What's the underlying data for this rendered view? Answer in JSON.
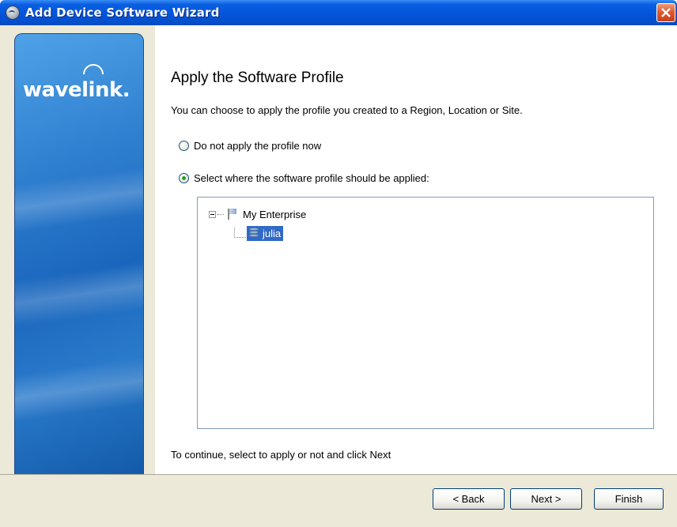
{
  "window": {
    "title": "Add Device Software Wizard",
    "close_icon": "close-icon"
  },
  "sidebar": {
    "logo": "wavelink."
  },
  "page": {
    "heading": "Apply the Software Profile",
    "subtitle": "You can choose to apply the profile you created to a Region, Location or Site.",
    "options": [
      {
        "label": "Do not apply the profile now",
        "checked": false
      },
      {
        "label": "Select where the software profile should be applied:",
        "checked": true
      }
    ],
    "tree": {
      "root": {
        "label": "My Enterprise",
        "icon": "flag-icon",
        "expanded": true
      },
      "child": {
        "label": "julia",
        "icon": "database-icon",
        "selected": true
      }
    },
    "footer_instruction": "To continue, select to apply or not and click Next"
  },
  "buttons": {
    "back": "< Back",
    "next": "Next >",
    "finish": "Finish"
  },
  "colors": {
    "titlebar": "#0456dc",
    "selection": "#316ac5",
    "dialog_bg": "#ece9d8"
  }
}
